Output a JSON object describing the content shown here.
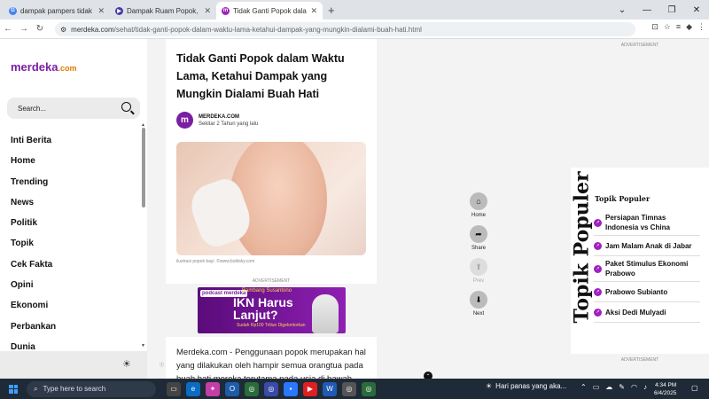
{
  "browser": {
    "tabs": [
      {
        "title": "dampak pampers tidak diganti",
        "fav_color": "#4285f4",
        "fav_text": "G"
      },
      {
        "title": "Dampak Ruam Popok, Bisa Han",
        "fav_color": "#4a3aa8",
        "fav_text": "▶"
      },
      {
        "title": "Tidak Ganti Popok dalam Waktu L",
        "fav_color": "#a020c0",
        "fav_text": "m"
      }
    ],
    "new_tab": "+",
    "url_host": "merdeka.com",
    "url_path": "/sehat/tidak-ganti-popok-dalam-waktu-lama-ketahui-dampak-yang-mungkin-dialami-buah-hati.html"
  },
  "sidebar": {
    "logo_main": "merdeka",
    "logo_suffix": ".com",
    "search_placeholder": "Search...",
    "menu": [
      "Inti Berita",
      "Home",
      "Trending",
      "News",
      "Politik",
      "Topik",
      "Cek Fakta",
      "Opini",
      "Ekonomi",
      "Perbankan",
      "Dunia"
    ]
  },
  "article": {
    "title": "Tidak Ganti Popok dalam Waktu Lama, Ketahui Dampak yang Mungkin Dialami Buah Hati",
    "author_initial": "m",
    "author": "MERDEKA.COM",
    "time": "Sekitar 2 Tahun yang lalu",
    "caption": "ilustrasi popok bayi. ©www.boldsky.com",
    "ad_label": "ADVERTISEMENT",
    "banner": {
      "logo": "podcast merdeka",
      "speaker": "Bambang Susantono",
      "headline": "IKN Harus Lanjut?",
      "sub": "Sudah Rp100 Triliun Digelontorkan"
    },
    "body": "Merdeka.com - Penggunaan popok merupakan hal yang dilakukan oleh hampir semua orangtua pada buah hati mereka terutama pada usia di bawah tiga"
  },
  "share": [
    {
      "label": "Home",
      "icon": "⌂",
      "enabled": true
    },
    {
      "label": "Share",
      "icon": "➦",
      "enabled": true
    },
    {
      "label": "Prev",
      "icon": "⬆",
      "enabled": false
    },
    {
      "label": "Next",
      "icon": "⬇",
      "enabled": true
    }
  ],
  "right": {
    "ad_label": "ADVERTISEMENT",
    "vertical_title": "Topik Populer",
    "heading": "Topik Populer",
    "topics": [
      "Persiapan Timnas Indonesia vs China",
      "Jam Malam Anak di Jabar",
      "Paket Stimulus Ekonomi Prabowo",
      "Prabowo Subianto",
      "Aksi Dedi Mulyadi"
    ],
    "ad_label_bottom": "ADVERTISEMENT"
  },
  "taskbar": {
    "search": "Type here to search",
    "weather": "Hari panas yang aka...",
    "time": "4:34 PM",
    "date": "6/4/2025"
  }
}
